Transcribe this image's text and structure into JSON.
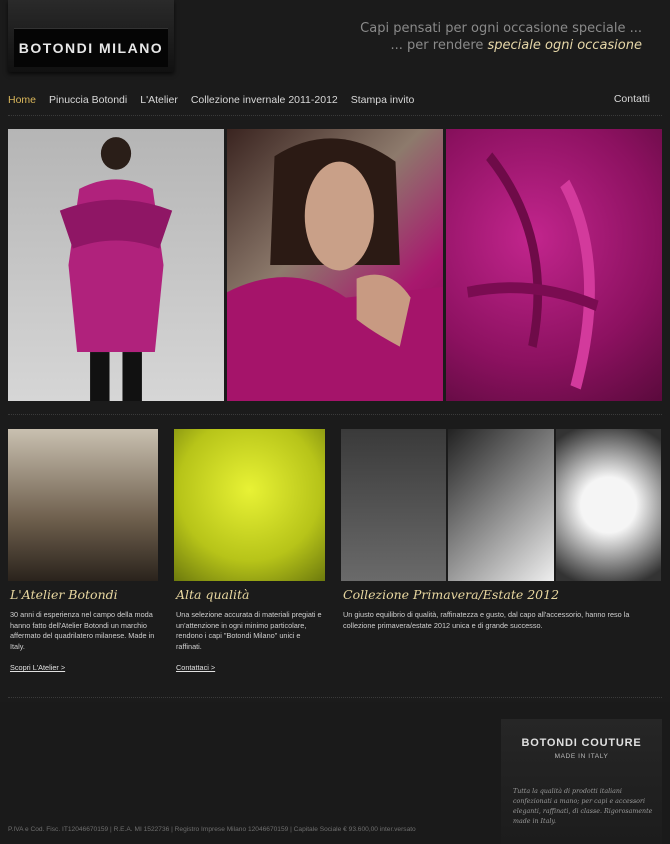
{
  "header": {
    "logo": "BOTONDI MILANO",
    "tagline_line1": "Capi pensati per ogni occasione speciale ...",
    "tagline_line2_prefix": "... per rendere ",
    "tagline_line2_emph": "speciale ogni occasione"
  },
  "nav": {
    "items": [
      "Home",
      "Pinuccia Botondi",
      "L'Atelier",
      "Collezione invernale 2011-2012",
      "Stampa invito"
    ],
    "contact": "Contatti"
  },
  "features": [
    {
      "title": "L'Atelier Botondi",
      "text": "30 anni di esperienza nel campo della moda hanno fatto dell'Atelier Botondi un marchio affermato del quadrilatero milanese. Made in Italy.",
      "link": "Scopri L'Atelier >"
    },
    {
      "title": "Alta qualità",
      "text": "Una selezione accurata di materiali pregiati e un'attenzione in ogni minimo particolare, rendono i capi \"Botondi Milano\" unici e raffinati.",
      "link": "Contattaci >"
    },
    {
      "title": "Collezione Primavera/Estate 2012",
      "text": "Un giusto equilibrio di qualità, raffinatezza e gusto, dal capo all'accessorio, hanno reso la collezione primavera/estate 2012 unica e di grande successo."
    }
  ],
  "footer": {
    "couture_title": "BOTONDI COUTURE",
    "couture_sub": "MADE IN ITALY",
    "couture_text": "Tutta la qualità di prodotti italiani confezionati a mano; per capi e accessori eleganti, raffinati, di classe. Rigorosamente made in Italy.",
    "legal": "P.IVA e Cod. Fisc. IT12046670159 | R.E.A. MI 1522736 | Registro Imprese Milano 12046670159 | Capitale Sociale € 93.600,00 inter.versato"
  }
}
